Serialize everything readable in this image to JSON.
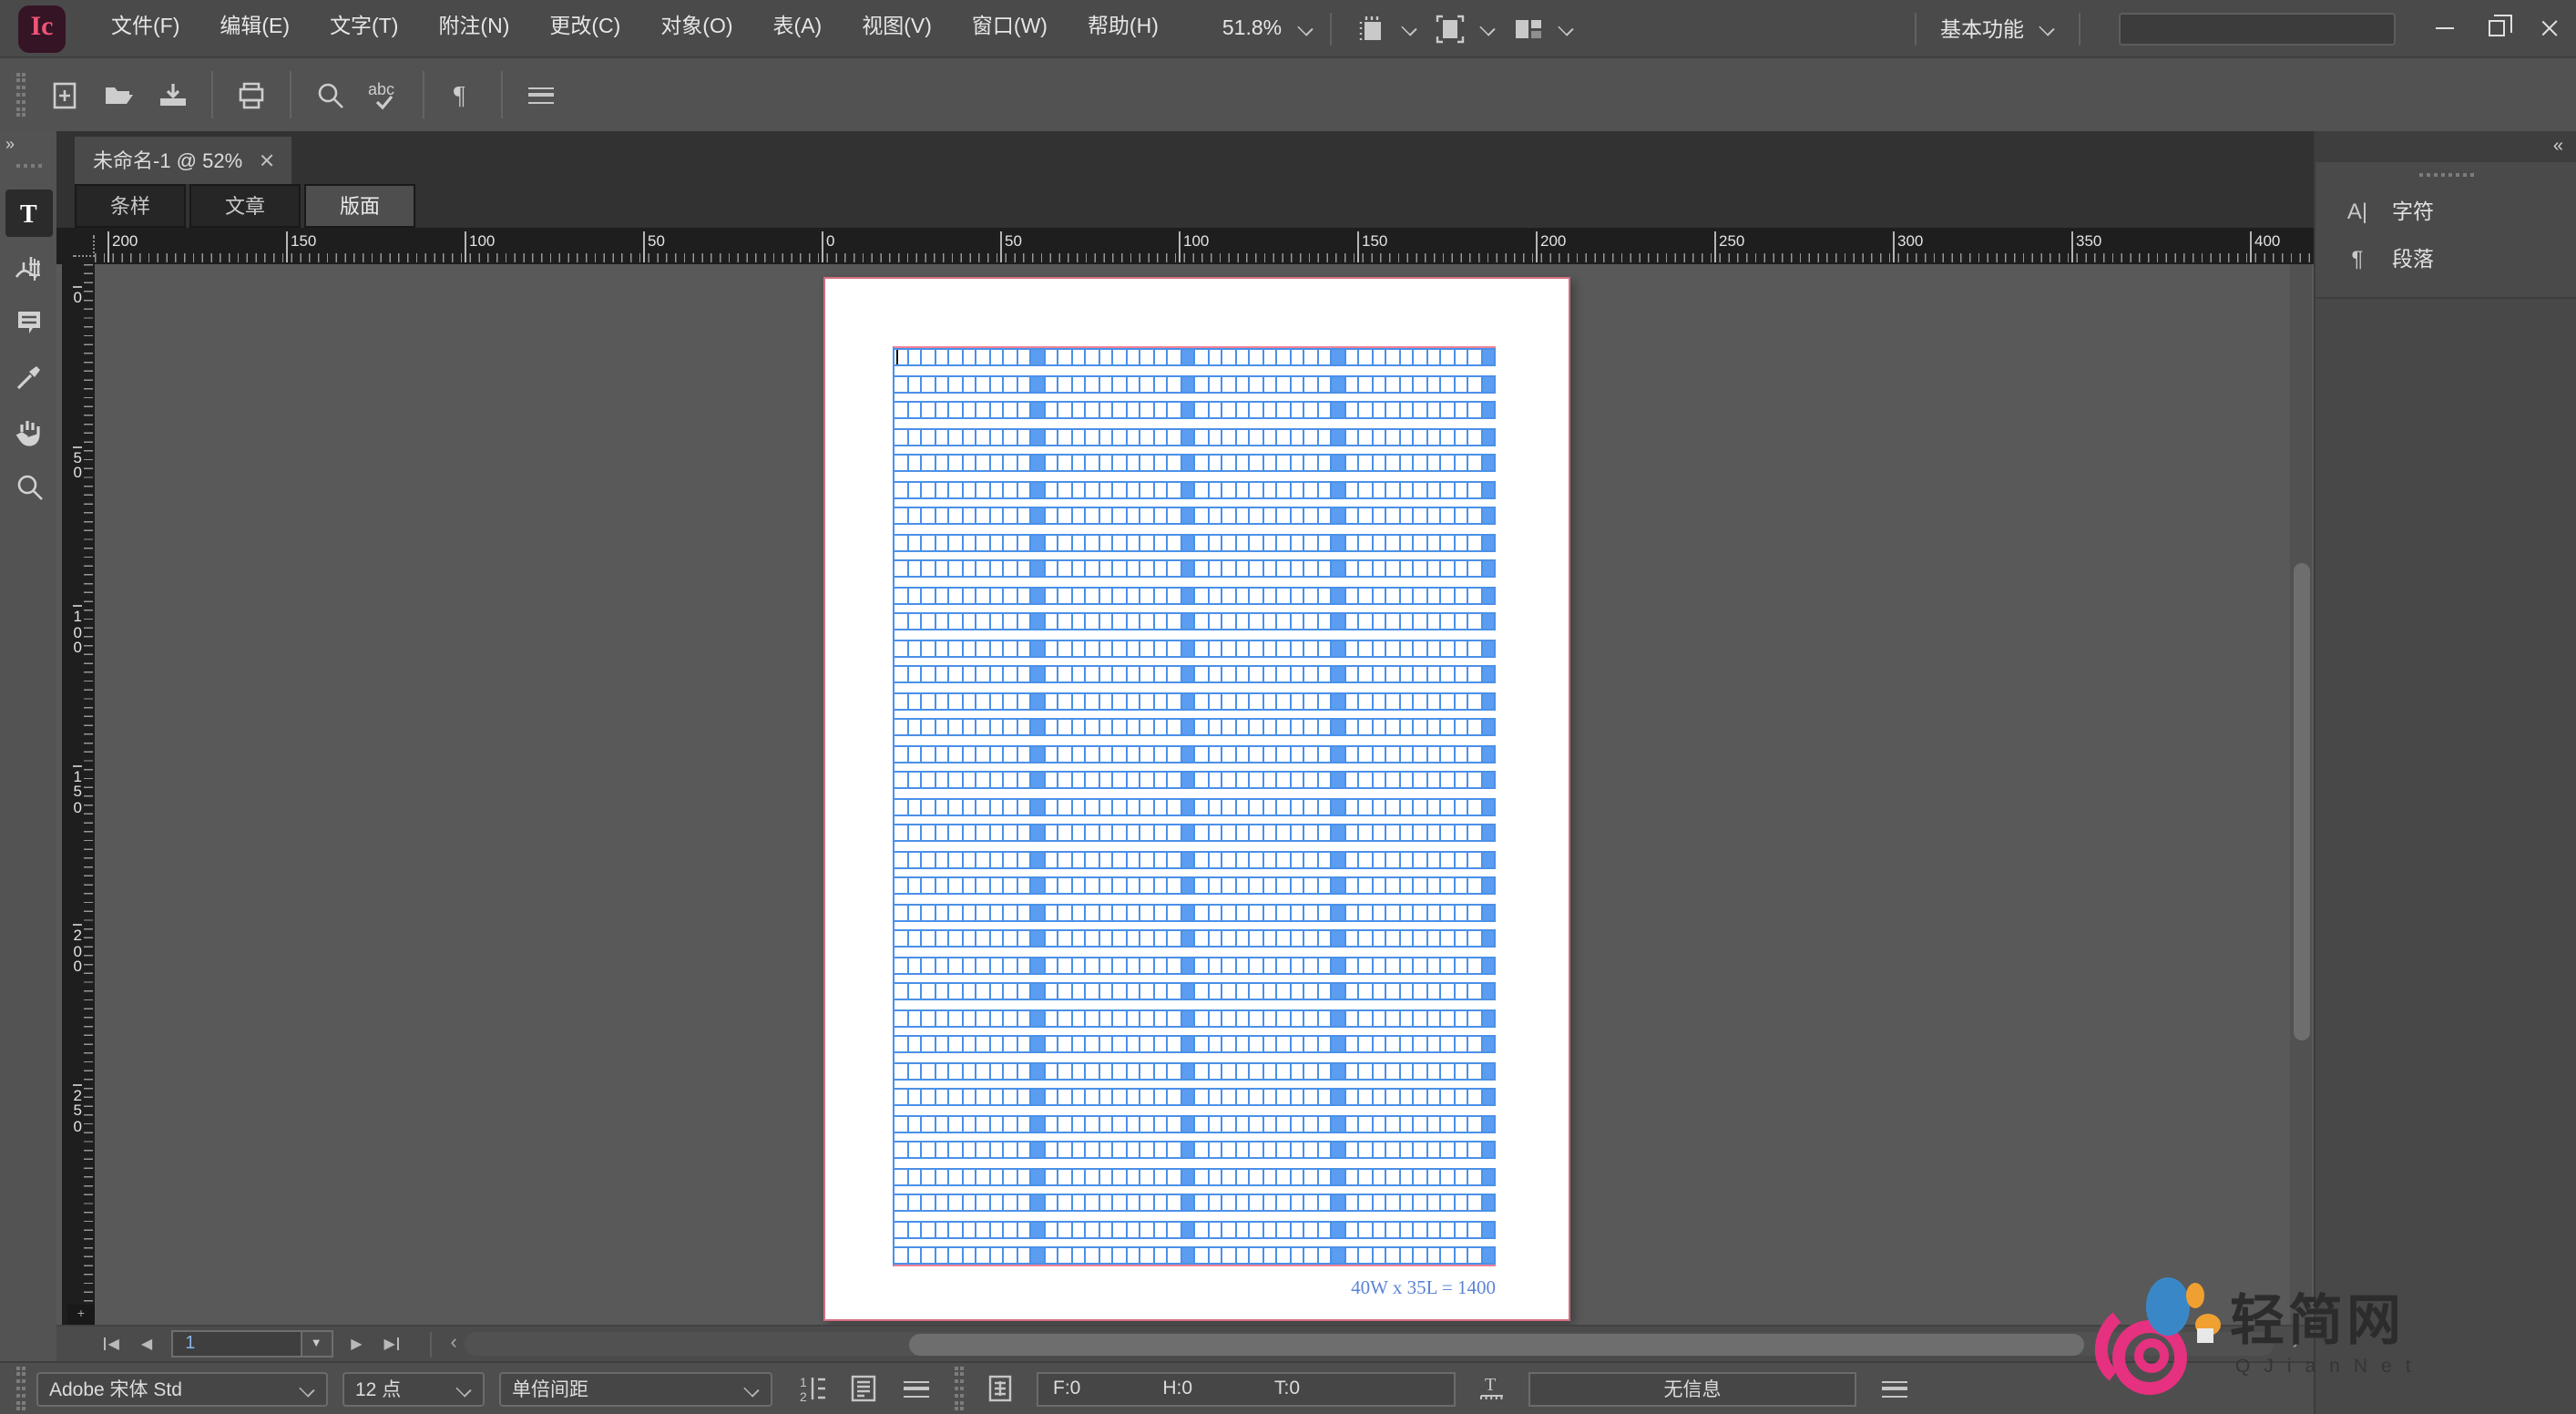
{
  "app": {
    "logo_text": "Ic"
  },
  "menubar": {
    "menus": [
      "文件(F)",
      "编辑(E)",
      "文字(T)",
      "附注(N)",
      "更改(C)",
      "对象(O)",
      "表(A)",
      "视图(V)",
      "窗口(W)",
      "帮助(H)"
    ],
    "zoom_value": "51.8%",
    "workspace": "基本功能",
    "search_value": "",
    "icons": [
      "view-options-icon",
      "text-frame-icon",
      "screen-mode-icon"
    ],
    "window_controls": [
      "minimize-icon",
      "restore-icon",
      "close-icon"
    ]
  },
  "toolbar_icons": [
    "new-document-icon",
    "open-folder-icon",
    "save-icon",
    "print-icon",
    "search-icon",
    "spellcheck-icon",
    "pilcrow-icon",
    "menu-icon"
  ],
  "tools": [
    "type-tool",
    "position-tool",
    "note-tool",
    "eyedropper-tool",
    "hand-tool",
    "zoom-tool"
  ],
  "document": {
    "tab_title": "未命名-1 @ 52%",
    "view_tabs": [
      "条样",
      "文章",
      "版面"
    ],
    "active_view_tab": "版面",
    "grid": {
      "rows": 35,
      "groups": 4,
      "cells_per_group": 10,
      "label": "40W x 35L = 1400"
    },
    "colors": {
      "grid_line": "#4a90e8",
      "grid_fill": "#5b9df0",
      "guide_pink": "#ef8298",
      "label_blue": "#5b84d6"
    }
  },
  "rulers": {
    "horizontal": [
      "200",
      "150",
      "100",
      "50",
      "0",
      "50",
      "100",
      "150",
      "200",
      "250",
      "300",
      "350",
      "400"
    ],
    "vertical": [
      "0",
      "50",
      "100",
      "150",
      "200",
      "250"
    ]
  },
  "page_nav": {
    "current_page": "1"
  },
  "status_bar": {
    "font_name": "Adobe 宋体 Std",
    "font_size": "12 点",
    "leading": "单倍间距",
    "footnote_count": "F:0",
    "hidden_count": "H:0",
    "table_count": "T:0",
    "info": "无信息"
  },
  "dock": {
    "panels": [
      {
        "icon": "character-panel-icon",
        "label": "字符"
      },
      {
        "icon": "paragraph-panel-icon",
        "label": "段落"
      }
    ]
  },
  "watermark": {
    "title": "轻简网",
    "subtitle": "QJianNet"
  }
}
